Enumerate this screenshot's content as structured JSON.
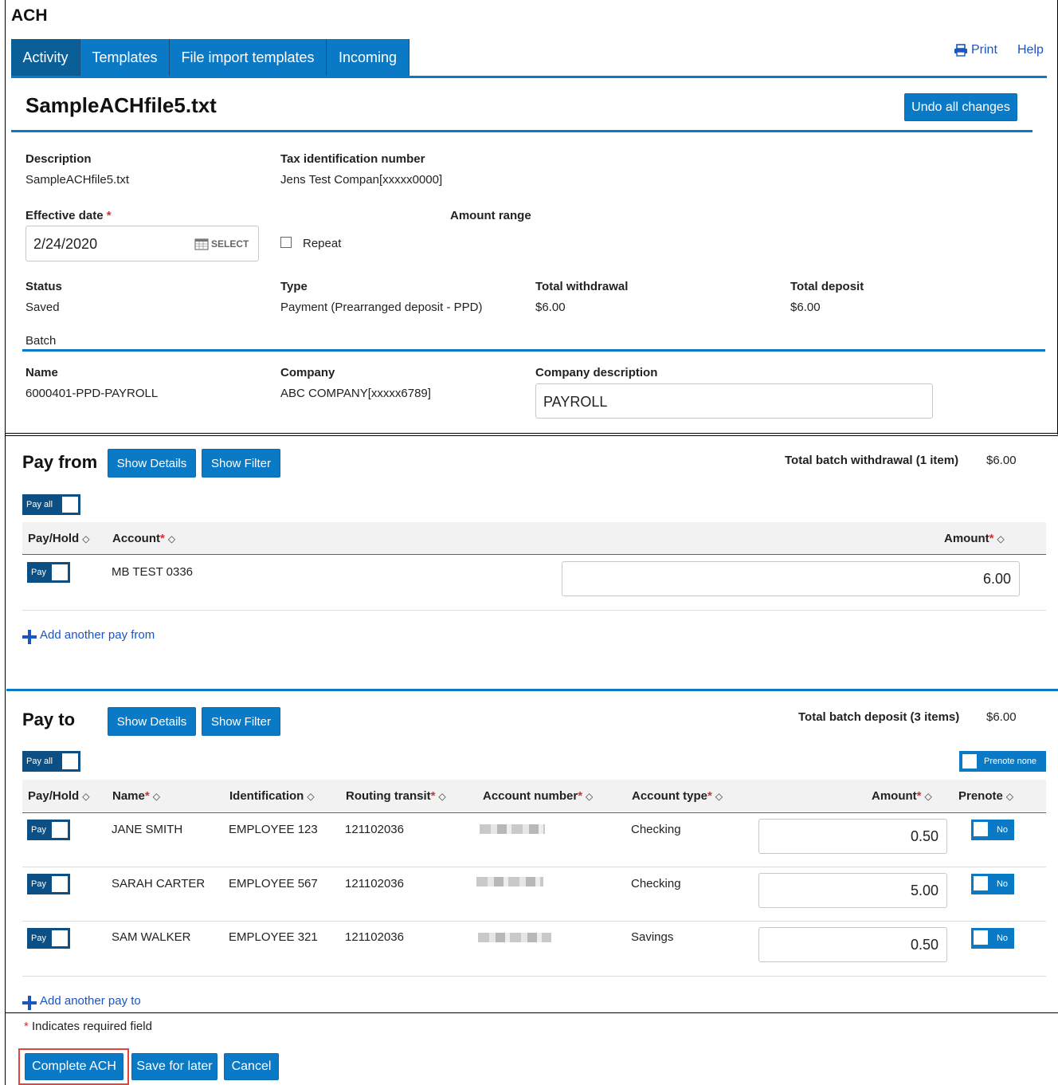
{
  "app": {
    "title": "ACH"
  },
  "tabs": [
    {
      "label": "Activity",
      "active": true
    },
    {
      "label": "Templates"
    },
    {
      "label": "File import templates"
    },
    {
      "label": "Incoming"
    }
  ],
  "header_links": {
    "print": "Print",
    "help": "Help"
  },
  "file": {
    "title": "SampleACHfile5.txt",
    "undo_label": "Undo all changes",
    "description_label": "Description",
    "description_value": "SampleACHfile5.txt",
    "tax_id_label": "Tax identification number",
    "tax_id_value": "Jens Test Compan[xxxxx0000]",
    "effective_date_label": "Effective date",
    "required_mark": "*",
    "effective_date_value": "2/24/2020",
    "select_label": "SELECT",
    "amount_range_label": "Amount range",
    "repeat_label": "Repeat",
    "repeat_checked": false,
    "status_label": "Status",
    "status_value": "Saved",
    "type_label": "Type",
    "type_value": "Payment (Prearranged deposit - PPD)",
    "total_withdrawal_label": "Total withdrawal",
    "total_withdrawal_value": "$6.00",
    "total_deposit_label": "Total deposit",
    "total_deposit_value": "$6.00",
    "batch_label": "Batch",
    "name_label": "Name",
    "name_value": "6000401-PPD-PAYROLL",
    "company_label": "Company",
    "company_value": "ABC COMPANY[xxxxx6789]",
    "company_desc_label": "Company description",
    "company_desc_value": "PAYROLL"
  },
  "pay_from": {
    "title": "Pay from",
    "show_details": "Show Details",
    "show_filter": "Show Filter",
    "total_label": "Total batch withdrawal (1 item)",
    "total_value": "$6.00",
    "pay_all_label": "Pay all",
    "columns": {
      "payhold": "Pay/Hold",
      "account": "Account",
      "amount": "Amount"
    },
    "rows": [
      {
        "toggle": "Pay",
        "account": "MB TEST 0336",
        "amount": "6.00"
      }
    ],
    "add_label": "Add another pay from"
  },
  "pay_to": {
    "title": "Pay to",
    "show_details": "Show Details",
    "show_filter": "Show Filter",
    "total_label": "Total batch deposit (3 items)",
    "total_value": "$6.00",
    "pay_all_label": "Pay all",
    "prenote_none_label": "Prenote none",
    "columns": {
      "payhold": "Pay/Hold",
      "name": "Name",
      "identification": "Identification",
      "routing": "Routing transit",
      "account_number": "Account number",
      "account_type": "Account type",
      "amount": "Amount",
      "prenote": "Prenote"
    },
    "rows": [
      {
        "toggle": "Pay",
        "name": "JANE SMITH",
        "identification": "EMPLOYEE 123",
        "routing": "121102036",
        "account_type": "Checking",
        "amount": "0.50",
        "prenote": "No"
      },
      {
        "toggle": "Pay",
        "name": "SARAH CARTER",
        "identification": "EMPLOYEE 567",
        "routing": "121102036",
        "account_type": "Checking",
        "amount": "5.00",
        "prenote": "No"
      },
      {
        "toggle": "Pay",
        "name": "SAM WALKER",
        "identification": "EMPLOYEE 321",
        "routing": "121102036",
        "account_type": "Savings",
        "amount": "0.50",
        "prenote": "No"
      }
    ],
    "add_label": "Add another pay to"
  },
  "footer": {
    "required_note": "Indicates required field",
    "complete_label": "Complete ACH",
    "save_label": "Save for later",
    "cancel_label": "Cancel"
  },
  "colors": {
    "accent": "#0a7ac6",
    "dark_accent": "#0b4f84",
    "link": "#1a55c2",
    "required": "#d0312d",
    "highlight_box": "#e0463f"
  }
}
